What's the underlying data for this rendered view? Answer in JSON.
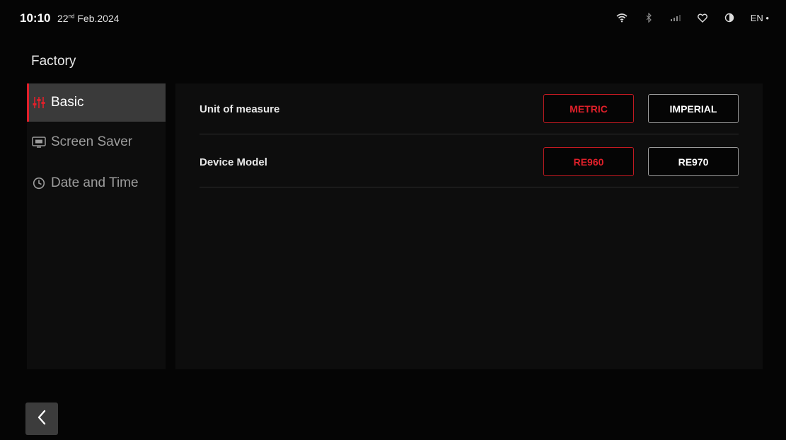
{
  "status_bar": {
    "time": "10:10",
    "date_day": "22",
    "date_suffix": "nd",
    "date_rest": " Feb.2024",
    "icons": [
      "wifi-icon",
      "bluetooth-icon",
      "signal-icon",
      "heart-icon",
      "contrast-icon"
    ],
    "language": "EN •"
  },
  "page": {
    "title": "Factory"
  },
  "sidebar": {
    "items": [
      {
        "label": "Basic",
        "icon": "sliders-icon",
        "active": true
      },
      {
        "label": "Screen Saver",
        "icon": "screen-saver-icon",
        "active": false
      },
      {
        "label": "Date and Time",
        "icon": "clock-icon",
        "active": false
      }
    ]
  },
  "settings": {
    "unit": {
      "label": "Unit of measure",
      "options": [
        "METRIC",
        "IMPERIAL"
      ],
      "selected": "METRIC"
    },
    "model": {
      "label": "Device Model",
      "options": [
        "RE960",
        "RE970"
      ],
      "selected": "RE960"
    }
  },
  "colors": {
    "accent": "#e0202a",
    "background": "#050505",
    "panel": "#0d0d0d",
    "active_item": "#3a3a3a"
  },
  "back_button": {
    "icon": "chevron-left-icon"
  }
}
